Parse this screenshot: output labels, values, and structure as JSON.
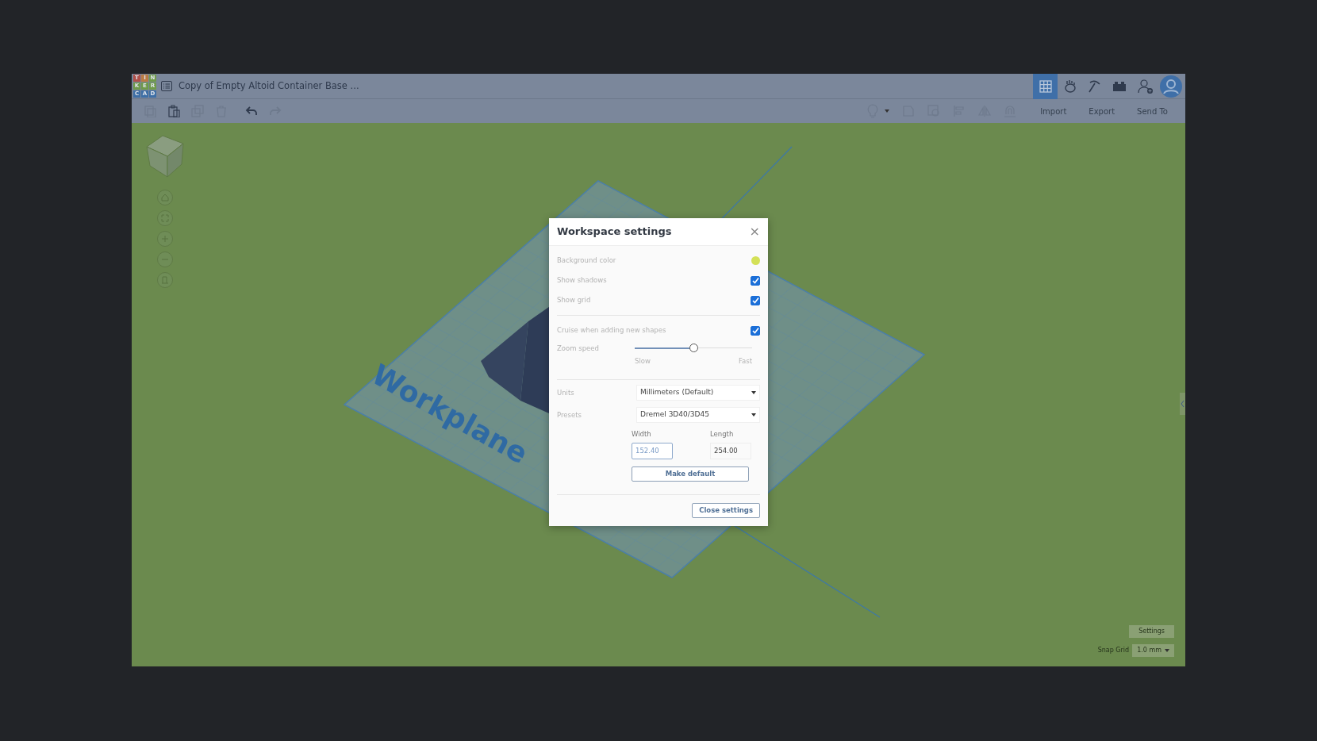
{
  "app": {
    "logo_letters": [
      {
        "letter": "T",
        "color": "#b0504a"
      },
      {
        "letter": "I",
        "color": "#b97a43"
      },
      {
        "letter": "N",
        "color": "#6f9a4a"
      },
      {
        "letter": "K",
        "color": "#6f9a4a"
      },
      {
        "letter": "E",
        "color": "#6f9a4a"
      },
      {
        "letter": "R",
        "color": "#6f9a4a"
      },
      {
        "letter": "C",
        "color": "#3e6fa6"
      },
      {
        "letter": "A",
        "color": "#3e6fa6"
      },
      {
        "letter": "D",
        "color": "#3e6fa6"
      }
    ],
    "document_title": "Copy of Empty Altoid Container Base ...",
    "view_modes": [
      {
        "kind": "grid",
        "selected": true
      },
      {
        "kind": "hand",
        "selected": false
      },
      {
        "kind": "pickaxe",
        "selected": false
      },
      {
        "kind": "bricks",
        "selected": false
      }
    ]
  },
  "toolbar": {
    "edit_tools": [
      {
        "kind": "copy",
        "disabled": true
      },
      {
        "kind": "paste",
        "disabled": false
      },
      {
        "kind": "duplicate",
        "disabled": true
      },
      {
        "kind": "delete",
        "disabled": true
      },
      {
        "kind": "undo",
        "disabled": false
      },
      {
        "kind": "redo",
        "disabled": true
      }
    ],
    "actions": [
      "Import",
      "Export",
      "Send To"
    ]
  },
  "workplane_label": "Workplane",
  "dialog": {
    "title": "Workspace settings",
    "close": "×",
    "rows": [
      {
        "kind": "color",
        "label": "Background color",
        "color": "#d4e157"
      },
      {
        "kind": "checkbox",
        "label": "Show shadows",
        "checked": true
      },
      {
        "kind": "checkbox",
        "label": "Show grid",
        "checked": true
      },
      {
        "kind": "divider"
      },
      {
        "kind": "checkbox",
        "label": "Cruise when adding new shapes",
        "checked": true
      }
    ],
    "zoom": {
      "label": "Zoom speed",
      "level": 0.5,
      "min_label": "Slow",
      "max_label": "Fast"
    },
    "units": {
      "label": "Units",
      "value": "Millimeters (Default)"
    },
    "presets": {
      "label": "Presets",
      "value": "Dremel 3D40/3D45"
    },
    "width": {
      "label": "Width",
      "value": "152.40"
    },
    "length": {
      "label": "Length",
      "value": "254.00"
    },
    "make_default": "Make default",
    "close_settings": "Close settings"
  },
  "footer": {
    "settings": "Settings",
    "snap_grid_label": "Snap Grid",
    "snap_grid_value": "1.0 mm"
  }
}
